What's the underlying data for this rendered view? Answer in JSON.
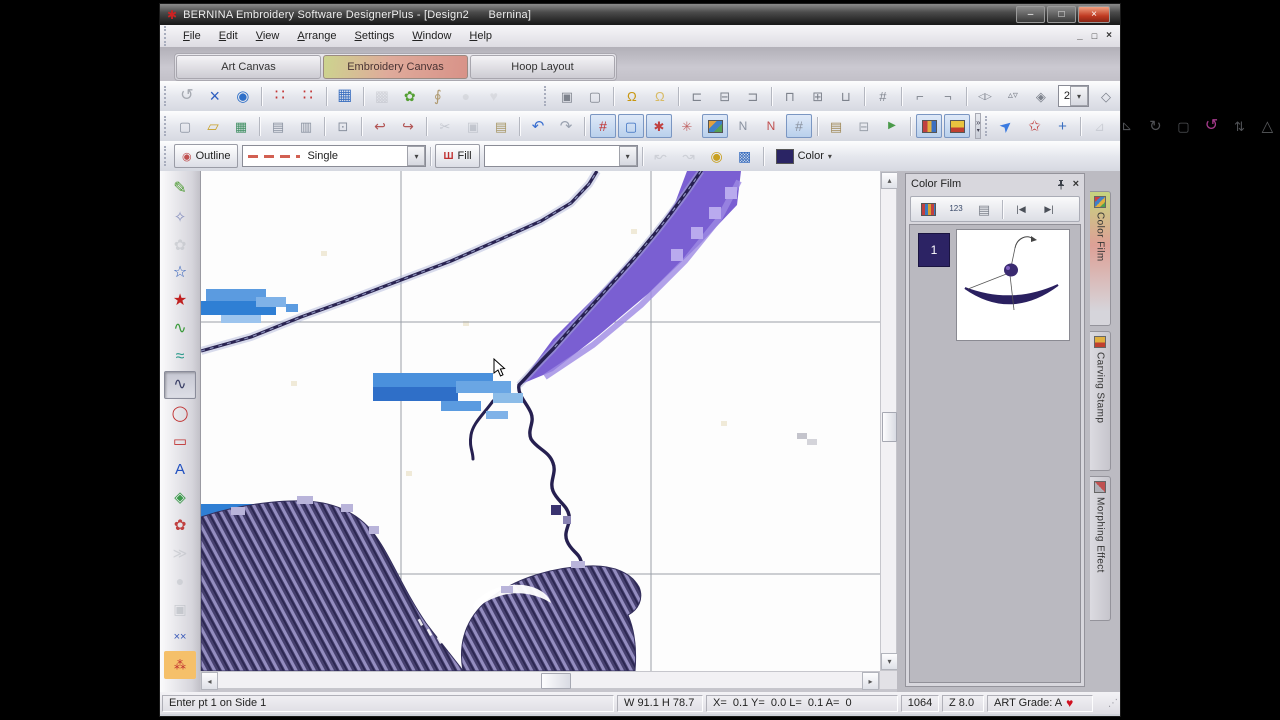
{
  "window": {
    "title": "BERNINA Embroidery Software DesignerPlus - [Design2      Bernina]",
    "icon_glyph": "✱",
    "minimize_glyph": "–",
    "maximize_glyph": "□",
    "close_glyph": "×"
  },
  "menu": {
    "items": [
      "File",
      "Edit",
      "View",
      "Arrange",
      "Settings",
      "Window",
      "Help"
    ]
  },
  "mdi": {
    "minimize_glyph": "_",
    "restore_glyph": "□",
    "close_glyph": "×"
  },
  "canvas_tabs": [
    {
      "label": "Art Canvas",
      "active": false
    },
    {
      "label": "Embroidery Canvas",
      "active": true
    },
    {
      "label": "Hoop Layout",
      "active": false
    }
  ],
  "ui": {
    "caret": "▾",
    "overflow_glyph": "»"
  },
  "toolbars": {
    "row1_left": [
      {
        "n": "swap-colors-icon",
        "g": "↺",
        "c": "#a6aab2",
        "fs": 16
      },
      {
        "n": "mirror-merge-icon",
        "g": "×",
        "c": "#2e5fc0",
        "fs": 18
      },
      {
        "n": "kaleidoscope-icon",
        "g": "◉",
        "c": "#2e6fc8",
        "fs": 15
      },
      {
        "sep": true
      },
      {
        "n": "dot-grid-icon",
        "g": "∷",
        "c": "#c23434",
        "fs": 16
      },
      {
        "n": "dot-array-icon",
        "g": "∷",
        "c": "#c23434",
        "fs": 16
      },
      {
        "sep": true
      },
      {
        "n": "quilter-grid-icon",
        "g": "▦",
        "c": "#3a6fc0",
        "fs": 16
      },
      {
        "sep": true
      },
      {
        "n": "lace-icon",
        "g": "▩",
        "c": "#b4b6be",
        "fs": 15,
        "disabled": true
      },
      {
        "n": "leaf-icon",
        "g": "✿",
        "c": "#55a035",
        "fs": 14
      },
      {
        "n": "paperclip-icon",
        "g": "∮",
        "c": "#b09a70",
        "fs": 15
      },
      {
        "n": "sphere-icon",
        "g": "●",
        "c": "#c6c8cc",
        "fs": 14,
        "disabled": true
      },
      {
        "n": "heart-icon",
        "g": "♥",
        "c": "#c9cacf",
        "fs": 14,
        "disabled": true
      }
    ],
    "row1_right": [
      {
        "n": "group-icon",
        "g": "▣",
        "c": "#7d828c"
      },
      {
        "n": "ungroup-icon",
        "g": "▢",
        "c": "#7d828c"
      },
      {
        "sep": true
      },
      {
        "n": "lock-icon",
        "g": "Ω",
        "c": "#c8960f"
      },
      {
        "n": "unlock-icon",
        "g": "Ω",
        "c": "#d8bb66"
      },
      {
        "sep": true
      },
      {
        "n": "align-left-icon",
        "g": "⊏",
        "c": "#7d828c"
      },
      {
        "n": "align-center-icon",
        "g": "⊟",
        "c": "#7d828c"
      },
      {
        "n": "align-right-icon",
        "g": "⊐",
        "c": "#7d828c"
      },
      {
        "sep": true
      },
      {
        "n": "align-top-icon",
        "g": "⊓",
        "c": "#7d828c"
      },
      {
        "n": "align-middle-icon",
        "g": "⊞",
        "c": "#7d828c"
      },
      {
        "n": "align-bottom-icon",
        "g": "⊔",
        "c": "#7d828c"
      },
      {
        "sep": true
      },
      {
        "n": "center-design-icon",
        "g": "#",
        "c": "#7d828c"
      },
      {
        "sep": true
      },
      {
        "n": "array-horizontal-icon",
        "g": "⌐",
        "c": "#7d828c"
      },
      {
        "n": "array-vertical-icon",
        "g": "¬",
        "c": "#7d828c"
      },
      {
        "sep": true
      },
      {
        "n": "mirror-horizontal-icon",
        "g": "◁▷",
        "c": "#7d828c",
        "fs": 9
      },
      {
        "n": "mirror-vertical-icon",
        "g": "▵▿",
        "c": "#7d828c",
        "fs": 10
      },
      {
        "n": "mirror-both-icon",
        "g": "◈",
        "c": "#7d828c"
      }
    ],
    "row1_count_value": "2",
    "row1_after": [
      {
        "n": "wreath-icon",
        "g": "◇",
        "c": "#7d828c"
      }
    ],
    "row2_left": [
      {
        "n": "new-icon",
        "g": "▢",
        "c": "#8a92a0"
      },
      {
        "n": "open-icon",
        "g": "▱",
        "c": "#c8a028",
        "fs": 15
      },
      {
        "n": "save-icon",
        "g": "▦",
        "c": "#3f8f62"
      },
      {
        "sep": true
      },
      {
        "n": "print-icon",
        "g": "▤",
        "c": "#8a92a0"
      },
      {
        "n": "print-preview-icon",
        "g": "▥",
        "c": "#8a92a0"
      },
      {
        "sep": true
      },
      {
        "n": "write-to-machine-icon",
        "g": "⊡",
        "c": "#8a92a0"
      },
      {
        "sep": true
      },
      {
        "n": "insert-artwork-icon",
        "g": "↩",
        "c": "#b25555",
        "fs": 14
      },
      {
        "n": "insert-embroidery-icon",
        "g": "↪",
        "c": "#b25555",
        "fs": 14
      },
      {
        "sep": true
      },
      {
        "n": "cut-icon",
        "g": "✂",
        "c": "#9aa0aa",
        "disabled": true
      },
      {
        "n": "copy-icon",
        "g": "▣",
        "c": "#9aa0aa",
        "disabled": true
      },
      {
        "n": "paste-icon",
        "g": "▤",
        "c": "#a89868"
      },
      {
        "sep": true
      },
      {
        "n": "undo-icon",
        "g": "↶",
        "c": "#3a6fd0",
        "fs": 15
      },
      {
        "n": "redo-icon",
        "g": "↷",
        "c": "#9aa2b0",
        "fs": 15
      },
      {
        "sep": true
      },
      {
        "n": "show-grid-icon",
        "g": "#",
        "c": "#c03030",
        "fs": 14,
        "active": true
      },
      {
        "n": "show-hoop-icon",
        "g": "▢",
        "c": "#3a6fc0",
        "active": true
      },
      {
        "n": "show-artwork-icon",
        "g": "✱",
        "c": "#c04040",
        "active": true
      },
      {
        "n": "dim-artwork-icon",
        "g": "✳",
        "c": "#c26666"
      },
      {
        "n": "background-icon",
        "type": "swatch",
        "bg": "linear-gradient(135deg,#e0a040 33%,#4080c8 33% 66%,#55a055 66%)",
        "active": true
      },
      {
        "n": "show-stitches-icon",
        "g": "N",
        "c": "#8a92a0",
        "fs": 12
      },
      {
        "n": "show-outlines-icon",
        "g": "N",
        "c": "#c05050",
        "fs": 12
      },
      {
        "n": "needle-points-icon",
        "g": "#",
        "c": "#8a92a0",
        "fs": 14,
        "active": true
      },
      {
        "sep": true
      },
      {
        "n": "print-order-icon",
        "g": "▤",
        "c": "#a08a5a"
      },
      {
        "n": "overview-window-icon",
        "g": "⊟",
        "c": "#9aa0aa"
      },
      {
        "n": "slow-redraw-icon",
        "g": "▶",
        "c": "#4a9a4a",
        "fs": 10
      },
      {
        "sep": true
      },
      {
        "n": "thread-colors-icon",
        "type": "swatch",
        "bg": "linear-gradient(90deg,#c04040 33%,#e0b040 33% 66%,#3a6fc0 66%)",
        "active": true
      },
      {
        "n": "stamp-icon",
        "type": "swatch",
        "bg": "linear-gradient(#e8c43f 60%,#c04030 60%)",
        "active": true
      }
    ],
    "row2_right": [
      {
        "n": "select-icon",
        "g": "➤",
        "c": "#3a7ae0",
        "fs": 15,
        "rot": -40
      },
      {
        "n": "reshape-icon",
        "g": "✩",
        "c": "#c04040",
        "fs": 15
      },
      {
        "n": "add-holes-icon",
        "g": "+",
        "c": "#3a6fc0",
        "fs": 15
      },
      {
        "sep": true
      },
      {
        "n": "mirror-x-icon",
        "g": "⊿",
        "c": "#b0b4bc",
        "disabled": true
      },
      {
        "n": "mirror-y-icon",
        "g": "⊿",
        "c": "#b0b4bc",
        "rot": 90,
        "disabled": true
      },
      {
        "n": "rotate-45-icon",
        "g": "↻",
        "c": "#b0b4bc",
        "fs": 15,
        "disabled": true
      },
      {
        "n": "scale-icon",
        "g": "▢",
        "c": "#b0b4bc",
        "disabled": true
      },
      {
        "n": "free-rotate-icon",
        "g": "↺",
        "c": "#a43a8a",
        "fs": 16
      },
      {
        "n": "skew-icon",
        "g": "⇅",
        "c": "#b0b4bc",
        "disabled": true
      },
      {
        "n": "perspective-icon",
        "g": "△",
        "c": "#c4c8ce",
        "fs": 15,
        "disabled": true
      }
    ]
  },
  "stitchbar": {
    "outline_label": "Outline",
    "outline_icon_glyph": "◉",
    "outline_style": "Single",
    "fill_label": "Fill",
    "fill_icon_glyph": "Ш",
    "fill_style": "",
    "color_label": "Color",
    "color_swatch": "#2a2464",
    "icons": [
      {
        "n": "outline-stitch-icon",
        "g": "↜",
        "c": "#b0b4bc",
        "fs": 15,
        "disabled": true
      },
      {
        "n": "fill-stitch-icon",
        "g": "↝",
        "c": "#b0b4bc",
        "fs": 15,
        "disabled": true
      },
      {
        "n": "pattern-icon",
        "g": "◉",
        "c": "#c8a020",
        "fs": 14
      },
      {
        "n": "texture-icon",
        "g": "▩",
        "c": "#3a6fc0",
        "fs": 14
      }
    ]
  },
  "palette": {
    "icons": [
      {
        "n": "open-freehand-icon",
        "g": "✎",
        "c": "#4a9a30",
        "fs": 16
      },
      {
        "n": "magic-wand-icon",
        "g": "✧",
        "c": "#8a93c0",
        "fs": 15
      },
      {
        "n": "auto-digitize-icon",
        "g": "✿",
        "c": "#b8bcc2",
        "fs": 15,
        "disabled": true
      },
      {
        "n": "digitize-open-icon",
        "g": "☆",
        "c": "#2858b8",
        "fs": 16
      },
      {
        "n": "digitize-closed-icon",
        "g": "★",
        "c": "#c02020",
        "fs": 16
      },
      {
        "n": "freehand-open-icon",
        "g": "∿",
        "c": "#3a9a3a",
        "fs": 16
      },
      {
        "n": "freehand-closed-icon",
        "g": "≈",
        "c": "#2a9a8a",
        "fs": 16
      },
      {
        "n": "open-object-icon",
        "g": "∿",
        "c": "#3a3f66",
        "fs": 16,
        "active": true
      },
      {
        "n": "ellipse-icon",
        "g": "◯",
        "c": "#c03030",
        "fs": 15
      },
      {
        "n": "rectangle-icon",
        "g": "▭",
        "c": "#c03030",
        "fs": 15
      },
      {
        "n": "lettering-icon",
        "g": "A",
        "c": "#2050c0",
        "fs": 15
      },
      {
        "n": "monogram-icon",
        "g": "◈",
        "c": "#3a9a4a",
        "fs": 15
      },
      {
        "n": "applique-icon",
        "g": "✿",
        "c": "#c04040",
        "fs": 15
      },
      {
        "n": "freehand-applique-icon",
        "g": "≫",
        "c": "#b8bcc2",
        "fs": 14,
        "disabled": true
      },
      {
        "n": "punchwork-icon",
        "g": "●",
        "c": "#bcc0c6",
        "fs": 14,
        "disabled": true
      },
      {
        "n": "outline-design-icon",
        "g": "▣",
        "c": "#aab0b6",
        "fs": 14,
        "disabled": true
      },
      {
        "n": "cross-stitch-icon",
        "g": "××",
        "c": "#3858b8",
        "fs": 11
      },
      {
        "n": "stipple-icon",
        "g": "⁂",
        "c": "#c03030",
        "fs": 12,
        "bgc": "#f5c06a"
      }
    ]
  },
  "film": {
    "title": "Color Film",
    "close_glyph": "×",
    "item_number": "1",
    "toolbar": [
      {
        "n": "film-strip-icon",
        "type": "swatch",
        "bg": "repeating-linear-gradient(90deg,#c04040 0 3px,#3a7ac0 3px 6px,#d8a030 6px 9px)"
      },
      {
        "n": "resequence-icon",
        "g": "123",
        "c": "#3a4a6a",
        "fs": 8
      },
      {
        "n": "sequence-by-color-icon",
        "g": "▤",
        "c": "#7d828c"
      },
      {
        "sep": true
      },
      {
        "n": "back-icon",
        "g": "|◀",
        "c": "#4a4f58",
        "fs": 9
      },
      {
        "n": "forward-icon",
        "g": "▶|",
        "c": "#4a4f58",
        "fs": 9
      }
    ],
    "tabs": [
      {
        "label": "Color Film",
        "active": true
      },
      {
        "label": "Carving Stamp",
        "active": false
      },
      {
        "label": "Morphing Effect",
        "active": false
      }
    ]
  },
  "scroll": {
    "up": "▴",
    "down": "▾",
    "left": "◂",
    "right": "▸"
  },
  "status": {
    "message": "Enter pt 1 on Side 1",
    "size": "W 91.1 H 78.7",
    "coords": "X=  0.1 Y=  0.0 L=  0.1 A=  0",
    "stitches": "1064",
    "zoom": "Z 8.0",
    "grade": "ART Grade: A",
    "heart_glyph": "♥",
    "grip_glyph": "⋰"
  },
  "canvas": {
    "colors": {
      "thread_navy": "#2b2553",
      "fill_purple": "#7a5fd2",
      "patch_blue": "#2f7fd4",
      "texture_dark": "#46406e",
      "texture_light": "#948dc0",
      "grid": "#9aa0a8"
    }
  }
}
